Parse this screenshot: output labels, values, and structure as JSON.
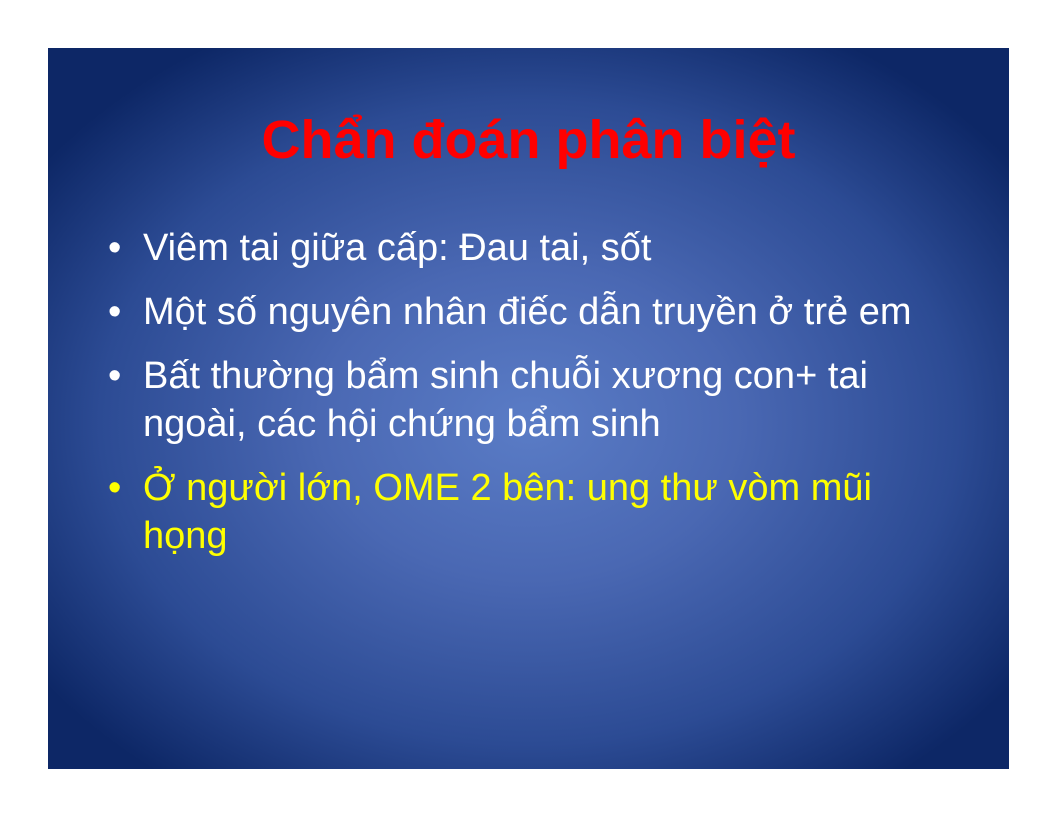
{
  "slide": {
    "title": "Chẩn đoán phân biệt",
    "bullet_symbol": "•",
    "bullets": [
      {
        "text": "Viêm tai giữa cấp: Đau tai, sốt"
      },
      {
        "text": "Một số nguyên nhân điếc dẫn truyền ở trẻ em"
      },
      {
        "text": "Bất thường bẩm sinh chuỗi xương con+ tai ngoài, các hội chứng bẩm sinh"
      },
      {
        "text": "Ở người lớn, OME 2 bên: ung thư vòm mũi họng"
      }
    ]
  },
  "colors": {
    "title": "#ff0000",
    "body_text": "#ffffff",
    "highlight_text": "#ffff00",
    "background_center": "#5a7cc6",
    "background_edge": "#0d2766"
  }
}
